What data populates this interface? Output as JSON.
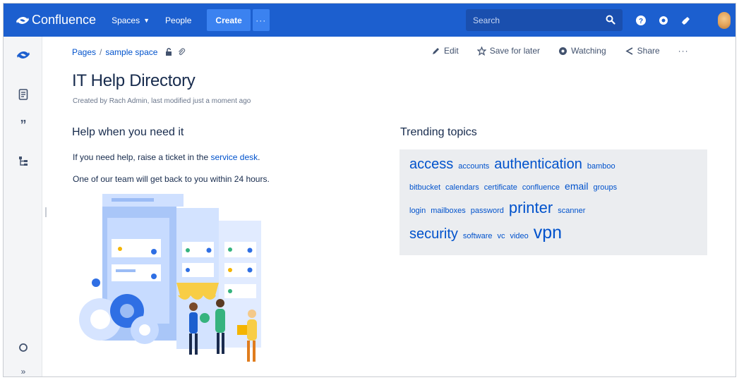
{
  "nav": {
    "product": "Confluence",
    "spaces": "Spaces",
    "people": "People",
    "create": "Create",
    "more": "···",
    "search_placeholder": "Search"
  },
  "breadcrumb": {
    "pages": "Pages",
    "separator": "/",
    "space": "sample space"
  },
  "actions": {
    "edit": "Edit",
    "save_for_later": "Save for later",
    "watching": "Watching",
    "share": "Share",
    "more": "···"
  },
  "page": {
    "title": "IT Help Directory",
    "byline": "Created by Rach Admin, last modified just a moment ago"
  },
  "help": {
    "heading": "Help when you need it",
    "line1_prefix": "If you need help, raise a ticket in the ",
    "line1_link": "service desk",
    "line1_suffix": ".",
    "line2": "One of our team will get back to you within 24 hours."
  },
  "trending": {
    "heading": "Trending topics",
    "lines": [
      [
        {
          "text": "access",
          "size": 20
        },
        {
          "text": "accounts",
          "size": 11
        },
        {
          "text": "authentication",
          "size": 20
        },
        {
          "text": "bamboo",
          "size": 11
        }
      ],
      [
        {
          "text": "bitbucket",
          "size": 11
        },
        {
          "text": "calendars",
          "size": 11
        },
        {
          "text": "certificate",
          "size": 11
        },
        {
          "text": "confluence",
          "size": 11
        },
        {
          "text": "email",
          "size": 14
        },
        {
          "text": "groups",
          "size": 11
        }
      ],
      [
        {
          "text": "login",
          "size": 11
        },
        {
          "text": "mailboxes",
          "size": 11
        },
        {
          "text": "password",
          "size": 11
        },
        {
          "text": "printer",
          "size": 22
        },
        {
          "text": "scanner",
          "size": 11
        }
      ],
      [
        {
          "text": "security",
          "size": 20
        },
        {
          "text": "software",
          "size": 11
        },
        {
          "text": "vc",
          "size": 11
        },
        {
          "text": "video",
          "size": 11
        },
        {
          "text": "vpn",
          "size": 25
        }
      ]
    ]
  },
  "colors": {
    "nav": "#1c5fcf",
    "link": "#0052cc",
    "cloud_bg": "#ebedf0"
  }
}
